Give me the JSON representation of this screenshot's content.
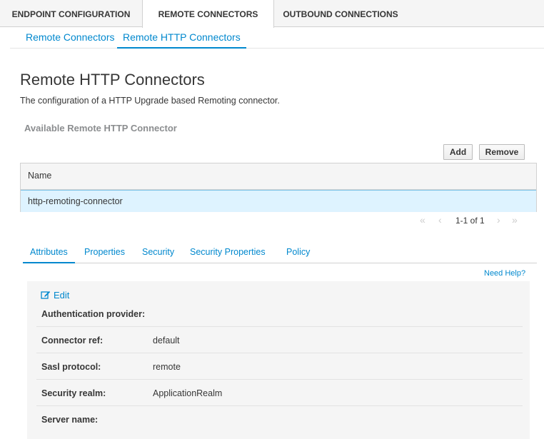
{
  "top_tabs": [
    {
      "label": "ENDPOINT CONFIGURATION"
    },
    {
      "label": "REMOTE CONNECTORS"
    },
    {
      "label": "OUTBOUND CONNECTIONS"
    }
  ],
  "sub_tabs": [
    {
      "label": "Remote Connectors"
    },
    {
      "label": "Remote HTTP Connectors"
    }
  ],
  "page": {
    "title": "Remote HTTP Connectors",
    "description": "The configuration of a HTTP Upgrade based Remoting connector.",
    "section_label": "Available Remote HTTP Connector"
  },
  "toolbar": {
    "add_label": "Add",
    "remove_label": "Remove"
  },
  "table": {
    "columns": [
      "Name"
    ],
    "rows": [
      {
        "name": "http-remoting-connector"
      }
    ]
  },
  "pager": {
    "text": "1-1 of 1",
    "first_icon": "double-chevron-left-icon",
    "prev_icon": "chevron-left-icon",
    "next_icon": "chevron-right-icon",
    "last_icon": "double-chevron-right-icon"
  },
  "detail_tabs": [
    {
      "label": "Attributes"
    },
    {
      "label": "Properties"
    },
    {
      "label": "Security"
    },
    {
      "label": "Security Properties"
    },
    {
      "label": "Policy"
    }
  ],
  "need_help": "Need Help?",
  "attributes": {
    "edit_label": "Edit",
    "edit_icon": "edit-icon",
    "rows": [
      {
        "label": "Authentication provider:",
        "value": ""
      },
      {
        "label": "Connector ref:",
        "value": "default"
      },
      {
        "label": "Sasl protocol:",
        "value": "remote"
      },
      {
        "label": "Security realm:",
        "value": "ApplicationRealm"
      },
      {
        "label": "Server name:",
        "value": ""
      }
    ]
  },
  "colors": {
    "accent": "#0088ce",
    "selected_row": "#def3ff",
    "panel_bg": "#f5f5f5"
  }
}
